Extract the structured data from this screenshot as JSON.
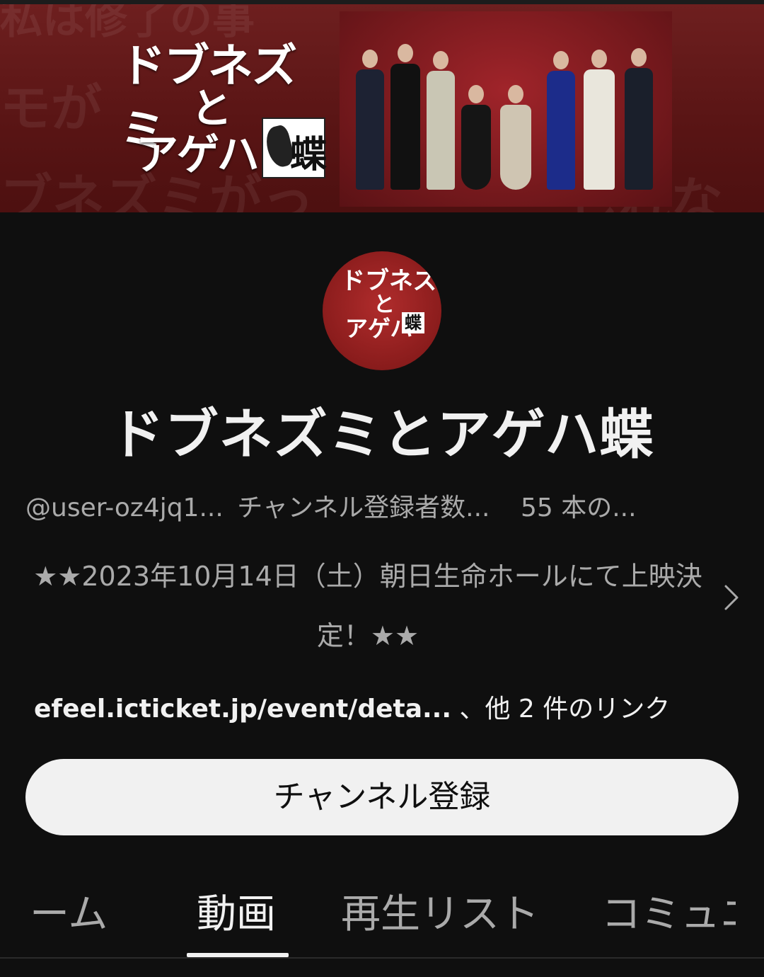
{
  "banner": {
    "logo_line1": "ドブネズミ",
    "logo_line2": "と",
    "logo_line3": "アゲハ",
    "logo_kanji": "蝶",
    "bg_text_1": "私は修了の事",
    "bg_text_2": "モが",
    "bg_text_3": "ブネズミがっ",
    "bg_text_4": "しれな"
  },
  "avatar": {
    "line1": "ドブネズミ",
    "line2": "と",
    "line3": "アゲハ",
    "kanji": "蝶"
  },
  "channel": {
    "name": "ドブネズミとアゲハ蝶",
    "handle": "@user-oz4jq1...",
    "subscribers": "チャンネル登録者数...",
    "videos": "55 本の...",
    "description": "★★2023年10月14日（土）朝日生命ホールにて上映決定！★★",
    "link_url": "efeel.icticket.jp/event/deta...",
    "link_more": "、他 2 件のリンク",
    "subscribe_label": "チャンネル登録"
  },
  "tabs": [
    {
      "label": "ホーム",
      "active": false
    },
    {
      "label": "動画",
      "active": true
    },
    {
      "label": "再生リスト",
      "active": false
    },
    {
      "label": "コミュニティ",
      "active": false
    }
  ],
  "colors": {
    "background": "#0f0f0f",
    "text_primary": "#f1f1f1",
    "text_secondary": "#aaaaaa",
    "banner_red": "#6e1f1f",
    "subscribe_bg": "#f1f1f1"
  }
}
